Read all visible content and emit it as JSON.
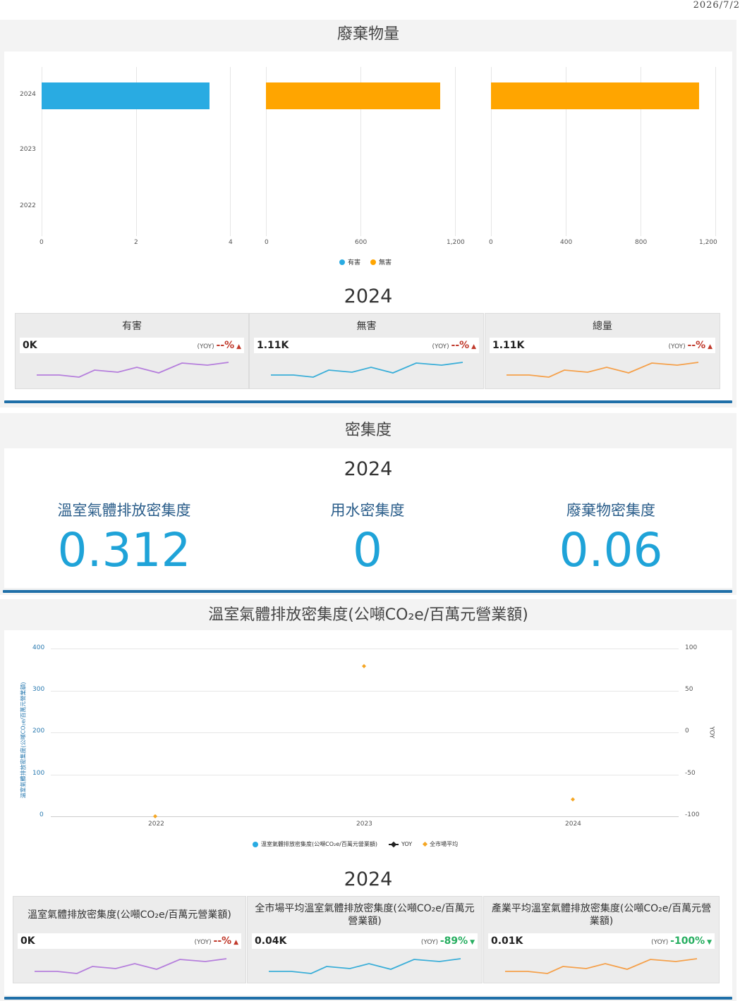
{
  "date": "2026/7/2",
  "waste": {
    "title": "廢棄物量",
    "y_categories": [
      "2024",
      "2023",
      "2022"
    ],
    "panels": [
      {
        "ticks": [
          "0",
          "2",
          "4"
        ],
        "color": "#29abe2"
      },
      {
        "ticks": [
          "0",
          "600",
          "1,200"
        ],
        "color": "#ffa500"
      },
      {
        "ticks": [
          "0",
          "400",
          "800",
          "1,200"
        ],
        "color": "#ffa500"
      }
    ],
    "legend": [
      {
        "label": "有害",
        "color": "#29abe2"
      },
      {
        "label": "無害",
        "color": "#ffa500"
      }
    ],
    "year": "2024",
    "cards": [
      {
        "title": "有害",
        "value": "0K",
        "yoy_label": "(YOY)",
        "yoy_pct": "--%",
        "arrow": "▲",
        "color": "#b57edc",
        "pct_color": "#c0392b"
      },
      {
        "title": "無害",
        "value": "1.11K",
        "yoy_label": "(YOY)",
        "yoy_pct": "--%",
        "arrow": "▲",
        "color": "#3aaed8",
        "pct_color": "#c0392b"
      },
      {
        "title": "總量",
        "value": "1.11K",
        "yoy_label": "(YOY)",
        "yoy_pct": "--%",
        "arrow": "▲",
        "color": "#f5a04a",
        "pct_color": "#c0392b"
      }
    ]
  },
  "density": {
    "title": "密集度",
    "year": "2024",
    "items": [
      {
        "label": "溫室氣體排放密集度",
        "value": "0.312"
      },
      {
        "label": "用水密集度",
        "value": "0"
      },
      {
        "label": "廢棄物密集度",
        "value": "0.06"
      }
    ]
  },
  "ghg": {
    "title": "溫室氣體排放密集度(公噸CO₂e/百萬元營業額)",
    "y_left_ticks": [
      "400",
      "300",
      "200",
      "100",
      "0"
    ],
    "y_right_ticks": [
      "100",
      "50",
      "0",
      "-50",
      "-100"
    ],
    "y_left_label": "溫室氣體排放密集度(公噸CO₂e/百萬元營業額)",
    "y_right_label": "YOY",
    "legend": [
      {
        "label": "溫室氣體排放密集度(公噸CO₂e/百萬元營業額)",
        "color": "#29abe2",
        "kind": "dot"
      },
      {
        "label": "YOY",
        "color": "#222",
        "kind": "line"
      },
      {
        "label": "全市場平均",
        "color": "#f5a623",
        "kind": "diamond"
      }
    ],
    "year": "2024",
    "cards": [
      {
        "title": "溫室氣體排放密集度(公噸CO₂e/百萬元營業額)",
        "value": "0K",
        "yoy_label": "(YOY)",
        "yoy_pct": "--%",
        "arrow": "▲",
        "color": "#b57edc",
        "pct_color": "#c0392b"
      },
      {
        "title": "全市場平均溫室氣體排放密集度(公噸CO₂e/百萬元營業額)",
        "value": "0.04K",
        "yoy_label": "(YOY)",
        "yoy_pct": "-89%",
        "arrow": "▼",
        "color": "#3aaed8",
        "pct_color": "#27ae60"
      },
      {
        "title": "產業平均溫室氣體排放密集度(公噸CO₂e/百萬元營業額)",
        "value": "0.01K",
        "yoy_label": "(YOY)",
        "yoy_pct": "-100%",
        "arrow": "▼",
        "color": "#f5a04a",
        "pct_color": "#27ae60"
      }
    ]
  },
  "chart_data": [
    {
      "type": "bar",
      "orientation": "horizontal",
      "title": "廢棄物量",
      "categories": [
        "2024",
        "2023",
        "2022"
      ],
      "series": [
        {
          "name": "有害",
          "values": [
            3.6,
            0,
            0
          ]
        },
        {
          "name": "無害",
          "values": [
            1110,
            0,
            0
          ]
        },
        {
          "name": "總量",
          "values": [
            1110,
            0,
            0
          ]
        }
      ],
      "xlim_panels": [
        [
          0,
          4
        ],
        [
          0,
          1200
        ],
        [
          0,
          1200
        ]
      ]
    },
    {
      "type": "scatter",
      "title": "溫室氣體排放密集度(公噸CO₂e/百萬元營業額)",
      "categories": [
        "2022",
        "2023",
        "2024"
      ],
      "series": [
        {
          "name": "全市場平均",
          "values": [
            0,
            359,
            40
          ]
        }
      ],
      "ylim": [
        0,
        400
      ],
      "y2lim": [
        -100,
        100
      ]
    }
  ]
}
